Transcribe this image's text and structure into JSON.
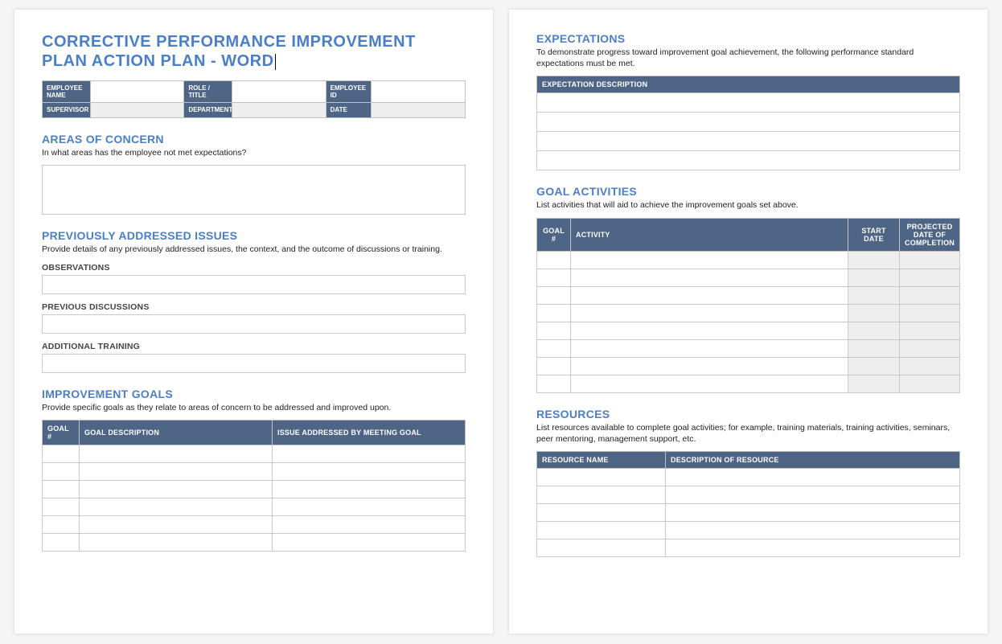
{
  "title": "CORRECTIVE PERFORMANCE IMPROVEMENT PLAN ACTION PLAN - WORD",
  "employee_info": {
    "labels": {
      "name": "EMPLOYEE NAME",
      "role": "ROLE / TITLE",
      "id": "EMPLOYEE ID",
      "supervisor": "SUPERVISOR",
      "department": "DEPARTMENT",
      "date": "DATE"
    }
  },
  "areas": {
    "heading": "AREAS OF CONCERN",
    "desc": "In what areas has the employee not met expectations?"
  },
  "prev": {
    "heading": "PREVIOUSLY ADDRESSED ISSUES",
    "desc": "Provide details of any previously addressed issues, the context, and the outcome of discussions or training.",
    "obs": "OBSERVATIONS",
    "disc": "PREVIOUS DISCUSSIONS",
    "train": "ADDITIONAL TRAINING"
  },
  "goals": {
    "heading": "IMPROVEMENT GOALS",
    "desc": "Provide specific goals as they relate to areas of concern to be addressed and improved upon.",
    "headers": {
      "num": "GOAL #",
      "desc": "GOAL DESCRIPTION",
      "issue": "ISSUE ADDRESSED BY MEETING GOAL"
    }
  },
  "exp": {
    "heading": "EXPECTATIONS",
    "desc": "To demonstrate progress toward improvement goal achievement, the following performance standard expectations must be met.",
    "header": "EXPECTATION DESCRIPTION"
  },
  "activities": {
    "heading": "GOAL ACTIVITIES",
    "desc": "List activities that will aid to achieve the improvement goals set above.",
    "headers": {
      "num": "GOAL #",
      "act": "ACTIVITY",
      "start": "START DATE",
      "proj": "PROJECTED DATE OF COMPLETION"
    }
  },
  "resources": {
    "heading": "RESOURCES",
    "desc": "List resources available to complete goal activities; for example, training materials, training activities, seminars, peer mentoring, management support, etc.",
    "headers": {
      "name": "RESOURCE NAME",
      "desc": "DESCRIPTION OF RESOURCE"
    }
  }
}
